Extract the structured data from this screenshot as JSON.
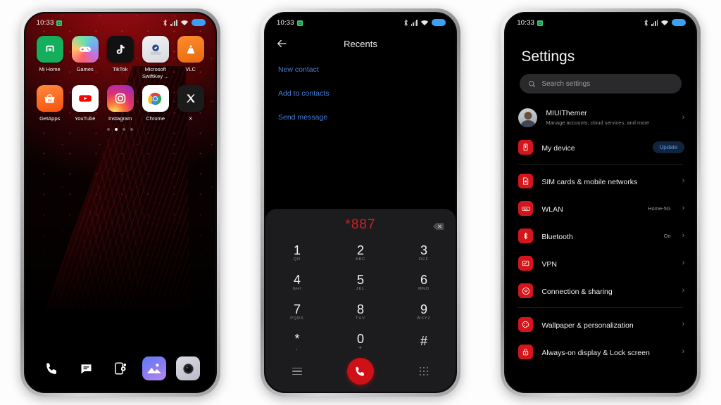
{
  "status_bar": {
    "time": "10:33",
    "icons": [
      "bluetooth-icon",
      "signal-icon",
      "wifi-icon",
      "battery-icon"
    ]
  },
  "phone_home": {
    "name": "home-screen",
    "apps_row1": [
      {
        "label": "Mi Home",
        "icon": "mi-home-icon"
      },
      {
        "label": "Games",
        "icon": "games-icon"
      },
      {
        "label": "TikTok",
        "icon": "tiktok-icon"
      },
      {
        "label": "Microsoft SwiftKey ...",
        "icon": "swiftkey-icon"
      },
      {
        "label": "VLC",
        "icon": "vlc-icon"
      }
    ],
    "apps_row2": [
      {
        "label": "GetApps",
        "icon": "getapps-icon"
      },
      {
        "label": "YouTube",
        "icon": "youtube-icon"
      },
      {
        "label": "Instagram",
        "icon": "instagram-icon"
      },
      {
        "label": "Chrome",
        "icon": "chrome-icon"
      },
      {
        "label": "X",
        "icon": "x-icon"
      }
    ],
    "page_dots": {
      "count": 4,
      "active_index": 1
    },
    "dock": [
      {
        "name": "phone-icon"
      },
      {
        "name": "messages-icon"
      },
      {
        "name": "device-settings-icon"
      },
      {
        "name": "gallery-icon"
      },
      {
        "name": "camera-icon"
      }
    ]
  },
  "phone_dialer": {
    "title": "Recents",
    "back": "back-arrow-icon",
    "actions": [
      "New contact",
      "Add to contacts",
      "Send message"
    ],
    "number": "*887",
    "backspace": "backspace-icon",
    "keys": [
      {
        "digit": "1",
        "sub": "QD"
      },
      {
        "digit": "2",
        "sub": "ABC"
      },
      {
        "digit": "3",
        "sub": "DEF"
      },
      {
        "digit": "4",
        "sub": "GHI"
      },
      {
        "digit": "5",
        "sub": "JKL"
      },
      {
        "digit": "6",
        "sub": "MNO"
      },
      {
        "digit": "7",
        "sub": "PQRS"
      },
      {
        "digit": "8",
        "sub": "TUV"
      },
      {
        "digit": "9",
        "sub": "WXYZ"
      },
      {
        "digit": "*",
        "sub": ","
      },
      {
        "digit": "0",
        "sub": "+"
      },
      {
        "digit": "#",
        "sub": ""
      }
    ],
    "bottom": {
      "menu": "hamburger-menu-icon",
      "call": "call-button",
      "keypad": "keypad-icon"
    },
    "accent_color": "#cf1016"
  },
  "phone_settings": {
    "title": "Settings",
    "search_placeholder": "Search settings",
    "account": {
      "name": "MIUIThemer",
      "subtitle": "Manage accounts, cloud services, and more"
    },
    "device": {
      "label": "My device",
      "badge": "Update"
    },
    "items": [
      {
        "label": "SIM cards & mobile networks",
        "value": "",
        "icon": "sim-card-icon"
      },
      {
        "label": "WLAN",
        "value": "Home-5G",
        "icon": "wlan-icon"
      },
      {
        "label": "Bluetooth",
        "value": "On",
        "icon": "bluetooth-icon"
      },
      {
        "label": "VPN",
        "value": "",
        "icon": "vpn-icon"
      },
      {
        "label": "Connection & sharing",
        "value": "",
        "icon": "connection-sharing-icon"
      }
    ],
    "items2": [
      {
        "label": "Wallpaper & personalization",
        "value": "",
        "icon": "wallpaper-icon"
      },
      {
        "label": "Always-on display & Lock screen",
        "value": "",
        "icon": "lock-screen-icon"
      }
    ],
    "icon_color": "#d4161c",
    "badge_color": "#5e9bf0"
  }
}
